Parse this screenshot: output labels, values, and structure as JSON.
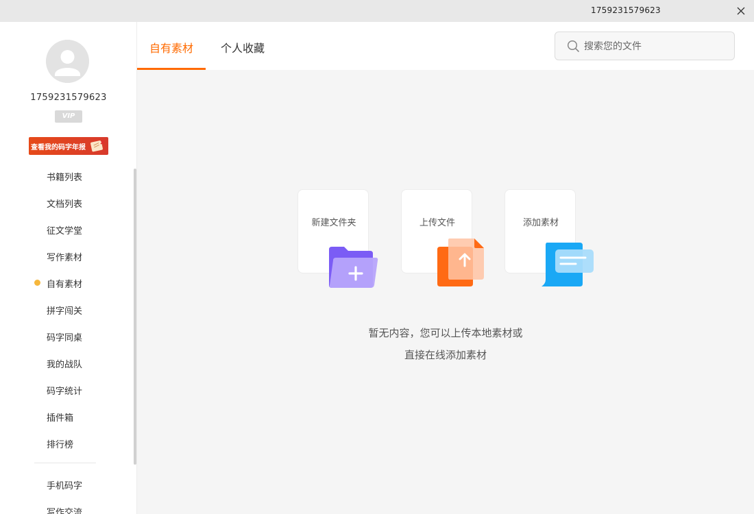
{
  "titlebar": {
    "title": "1759231579623"
  },
  "user": {
    "name": "1759231579623",
    "vip": "VIP"
  },
  "report_banner": {
    "label": "查看我的码字年报"
  },
  "nav": {
    "items": [
      {
        "label": "书籍列表"
      },
      {
        "label": "文档列表"
      },
      {
        "label": "征文学堂"
      },
      {
        "label": "写作素材"
      },
      {
        "label": "自有素材",
        "active": true
      },
      {
        "label": "拼字闯关"
      },
      {
        "label": "码字同桌"
      },
      {
        "label": "我的战队"
      },
      {
        "label": "码字统计"
      },
      {
        "label": "插件箱"
      },
      {
        "label": "排行榜"
      }
    ],
    "extra": [
      {
        "label": "手机码字"
      },
      {
        "label": "写作交流"
      }
    ]
  },
  "tabs": [
    {
      "label": "自有素材",
      "active": true
    },
    {
      "label": "个人收藏"
    }
  ],
  "search": {
    "placeholder": "搜索您的文件"
  },
  "cards": [
    {
      "label": "新建文件夹",
      "icon": "folder-plus-icon"
    },
    {
      "label": "上传文件",
      "icon": "upload-file-icon"
    },
    {
      "label": "添加素材",
      "icon": "material-doc-icon"
    }
  ],
  "empty": {
    "line1": "暂无内容，您可以上传本地素材或",
    "line2": "直接在线添加素材"
  },
  "colors": {
    "accent": "#ff6a00",
    "active_dot": "#f6b73c"
  }
}
